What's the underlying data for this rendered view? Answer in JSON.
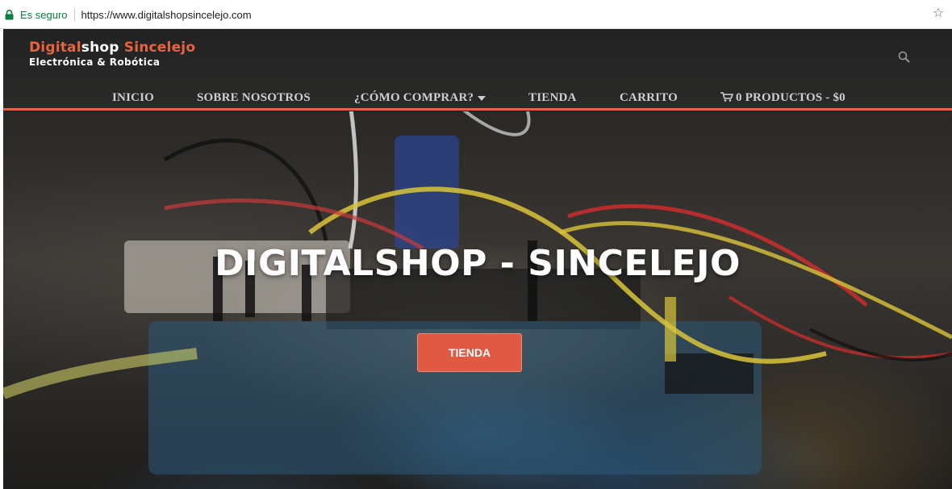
{
  "browser": {
    "secure_label": "Es seguro",
    "url": "https://www.digitalshopsincelejo.com",
    "lock_icon": "lock-icon",
    "star_icon": "star-icon"
  },
  "logo": {
    "part1": "Digital",
    "part2": "shop",
    "part3": " Sincelejo",
    "tagline": "Electrónica & Robótica"
  },
  "header": {
    "search_icon": "search-icon",
    "accent_color": "#e8643f"
  },
  "nav": {
    "items": [
      {
        "label": "INICIO"
      },
      {
        "label": "SOBRE NOSOTROS"
      },
      {
        "label": "¿CÓMO COMPRAR?"
      },
      {
        "label": "TIENDA"
      },
      {
        "label": "CARRITO"
      },
      {
        "label": "0 PRODUCTOS - $0"
      }
    ]
  },
  "hero": {
    "title": "DIGITALSHOP - SINCELEJO",
    "button_label": "TIENDA",
    "button_color": "#e05a43"
  }
}
